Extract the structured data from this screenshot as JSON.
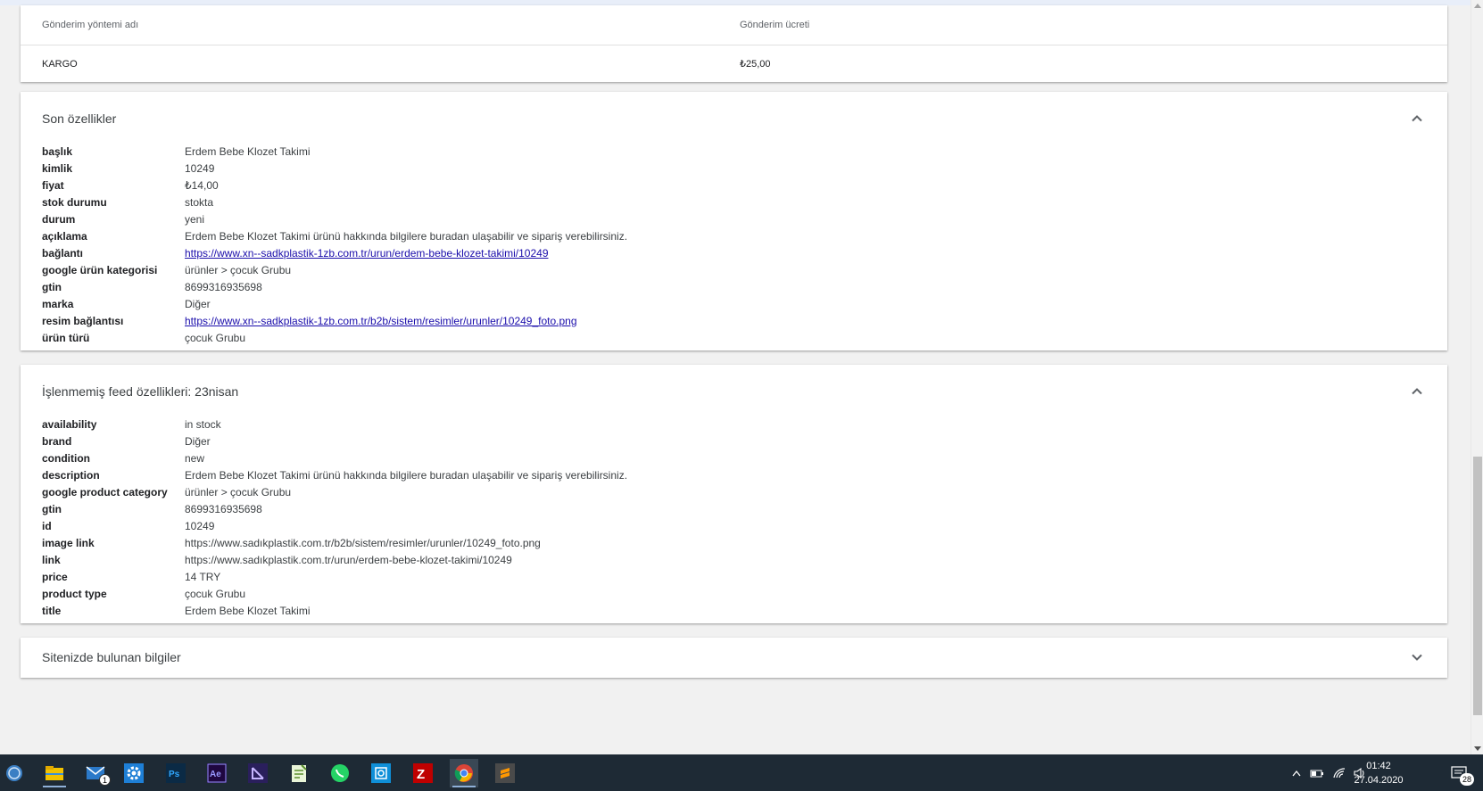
{
  "shipping": {
    "col_name_header": "Gönderim yöntemi adı",
    "col_fee_header": "Gönderim ücreti",
    "rows": [
      {
        "name": "KARGO",
        "fee": "₺25,00"
      }
    ]
  },
  "final_attributes": {
    "title": "Son özellikler",
    "expanded": true,
    "rows": [
      {
        "key": "başlık",
        "value": "Erdem Bebe Klozet Takimi"
      },
      {
        "key": "kimlik",
        "value": "10249"
      },
      {
        "key": "fiyat",
        "value": "₺14,00"
      },
      {
        "key": "stok durumu",
        "value": "stokta"
      },
      {
        "key": "durum",
        "value": "yeni"
      },
      {
        "key": "açıklama",
        "value": "Erdem Bebe Klozet Takimi ürünü hakkında bilgilere buradan ulaşabilir ve sipariş verebilirsiniz."
      },
      {
        "key": "bağlantı",
        "value": "https://www.xn--sadkplastik-1zb.com.tr/urun/erdem-bebe-klozet-takimi/10249",
        "link": true
      },
      {
        "key": "google ürün kategorisi",
        "value": "ürünler > çocuk Grubu"
      },
      {
        "key": "gtin",
        "value": "8699316935698"
      },
      {
        "key": "marka",
        "value": "Diğer"
      },
      {
        "key": "resim bağlantısı",
        "value": "https://www.xn--sadkplastik-1zb.com.tr/b2b/sistem/resimler/urunler/10249_foto.png",
        "link": true
      },
      {
        "key": "ürün türü",
        "value": "çocuk Grubu"
      }
    ]
  },
  "raw_feed_attributes": {
    "title": "İşlenmemiş feed özellikleri: 23nisan",
    "expanded": true,
    "rows": [
      {
        "key": "availability",
        "value": "in stock"
      },
      {
        "key": "brand",
        "value": "Diğer"
      },
      {
        "key": "condition",
        "value": "new"
      },
      {
        "key": "description",
        "value": "Erdem Bebe Klozet Takimi ürünü hakkında bilgilere buradan ulaşabilir ve sipariş verebilirsiniz."
      },
      {
        "key": "google product category",
        "value": "ürünler > çocuk Grubu"
      },
      {
        "key": "gtin",
        "value": "8699316935698"
      },
      {
        "key": "id",
        "value": "10249"
      },
      {
        "key": "image link",
        "value": "https://www.sadıkplastik.com.tr/b2b/sistem/resimler/urunler/10249_foto.png"
      },
      {
        "key": "link",
        "value": "https://www.sadıkplastik.com.tr/urun/erdem-bebe-klozet-takimi/10249"
      },
      {
        "key": "price",
        "value": "14 TRY"
      },
      {
        "key": "product type",
        "value": "çocuk Grubu"
      },
      {
        "key": "title",
        "value": "Erdem Bebe Klozet Takimi"
      }
    ]
  },
  "site_info": {
    "title": "Sitenizde bulunan bilgiler",
    "expanded": false
  },
  "taskbar": {
    "apps": [
      "start-icon",
      "file-explorer-icon",
      "mail-icon",
      "settings-icon",
      "photoshop-icon",
      "after-effects-icon",
      "app-purple-icon",
      "notes-icon",
      "whatsapp-icon",
      "app-blue-icon",
      "filezilla-icon",
      "chrome-icon",
      "sublime-icon"
    ],
    "mail_badge": "1",
    "time": "01:42",
    "date": "27.04.2020",
    "notification_count": "28"
  },
  "colors": {
    "link": "#1a0dab",
    "taskbar": "#1e2a35",
    "page_bg": "#f1f1f1"
  }
}
